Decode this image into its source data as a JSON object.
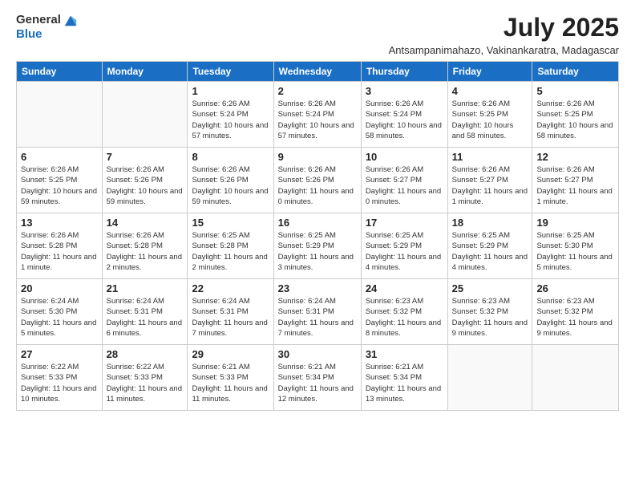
{
  "logo": {
    "general": "General",
    "blue": "Blue"
  },
  "title": "July 2025",
  "subtitle": "Antsampanimahazo, Vakinankaratra, Madagascar",
  "days_of_week": [
    "Sunday",
    "Monday",
    "Tuesday",
    "Wednesday",
    "Thursday",
    "Friday",
    "Saturday"
  ],
  "weeks": [
    [
      {
        "day": "",
        "info": ""
      },
      {
        "day": "",
        "info": ""
      },
      {
        "day": "1",
        "info": "Sunrise: 6:26 AM\nSunset: 5:24 PM\nDaylight: 10 hours and 57 minutes."
      },
      {
        "day": "2",
        "info": "Sunrise: 6:26 AM\nSunset: 5:24 PM\nDaylight: 10 hours and 57 minutes."
      },
      {
        "day": "3",
        "info": "Sunrise: 6:26 AM\nSunset: 5:24 PM\nDaylight: 10 hours and 58 minutes."
      },
      {
        "day": "4",
        "info": "Sunrise: 6:26 AM\nSunset: 5:25 PM\nDaylight: 10 hours and 58 minutes."
      },
      {
        "day": "5",
        "info": "Sunrise: 6:26 AM\nSunset: 5:25 PM\nDaylight: 10 hours and 58 minutes."
      }
    ],
    [
      {
        "day": "6",
        "info": "Sunrise: 6:26 AM\nSunset: 5:25 PM\nDaylight: 10 hours and 59 minutes."
      },
      {
        "day": "7",
        "info": "Sunrise: 6:26 AM\nSunset: 5:26 PM\nDaylight: 10 hours and 59 minutes."
      },
      {
        "day": "8",
        "info": "Sunrise: 6:26 AM\nSunset: 5:26 PM\nDaylight: 10 hours and 59 minutes."
      },
      {
        "day": "9",
        "info": "Sunrise: 6:26 AM\nSunset: 5:26 PM\nDaylight: 11 hours and 0 minutes."
      },
      {
        "day": "10",
        "info": "Sunrise: 6:26 AM\nSunset: 5:27 PM\nDaylight: 11 hours and 0 minutes."
      },
      {
        "day": "11",
        "info": "Sunrise: 6:26 AM\nSunset: 5:27 PM\nDaylight: 11 hours and 1 minute."
      },
      {
        "day": "12",
        "info": "Sunrise: 6:26 AM\nSunset: 5:27 PM\nDaylight: 11 hours and 1 minute."
      }
    ],
    [
      {
        "day": "13",
        "info": "Sunrise: 6:26 AM\nSunset: 5:28 PM\nDaylight: 11 hours and 1 minute."
      },
      {
        "day": "14",
        "info": "Sunrise: 6:26 AM\nSunset: 5:28 PM\nDaylight: 11 hours and 2 minutes."
      },
      {
        "day": "15",
        "info": "Sunrise: 6:25 AM\nSunset: 5:28 PM\nDaylight: 11 hours and 2 minutes."
      },
      {
        "day": "16",
        "info": "Sunrise: 6:25 AM\nSunset: 5:29 PM\nDaylight: 11 hours and 3 minutes."
      },
      {
        "day": "17",
        "info": "Sunrise: 6:25 AM\nSunset: 5:29 PM\nDaylight: 11 hours and 4 minutes."
      },
      {
        "day": "18",
        "info": "Sunrise: 6:25 AM\nSunset: 5:29 PM\nDaylight: 11 hours and 4 minutes."
      },
      {
        "day": "19",
        "info": "Sunrise: 6:25 AM\nSunset: 5:30 PM\nDaylight: 11 hours and 5 minutes."
      }
    ],
    [
      {
        "day": "20",
        "info": "Sunrise: 6:24 AM\nSunset: 5:30 PM\nDaylight: 11 hours and 5 minutes."
      },
      {
        "day": "21",
        "info": "Sunrise: 6:24 AM\nSunset: 5:31 PM\nDaylight: 11 hours and 6 minutes."
      },
      {
        "day": "22",
        "info": "Sunrise: 6:24 AM\nSunset: 5:31 PM\nDaylight: 11 hours and 7 minutes."
      },
      {
        "day": "23",
        "info": "Sunrise: 6:24 AM\nSunset: 5:31 PM\nDaylight: 11 hours and 7 minutes."
      },
      {
        "day": "24",
        "info": "Sunrise: 6:23 AM\nSunset: 5:32 PM\nDaylight: 11 hours and 8 minutes."
      },
      {
        "day": "25",
        "info": "Sunrise: 6:23 AM\nSunset: 5:32 PM\nDaylight: 11 hours and 9 minutes."
      },
      {
        "day": "26",
        "info": "Sunrise: 6:23 AM\nSunset: 5:32 PM\nDaylight: 11 hours and 9 minutes."
      }
    ],
    [
      {
        "day": "27",
        "info": "Sunrise: 6:22 AM\nSunset: 5:33 PM\nDaylight: 11 hours and 10 minutes."
      },
      {
        "day": "28",
        "info": "Sunrise: 6:22 AM\nSunset: 5:33 PM\nDaylight: 11 hours and 11 minutes."
      },
      {
        "day": "29",
        "info": "Sunrise: 6:21 AM\nSunset: 5:33 PM\nDaylight: 11 hours and 11 minutes."
      },
      {
        "day": "30",
        "info": "Sunrise: 6:21 AM\nSunset: 5:34 PM\nDaylight: 11 hours and 12 minutes."
      },
      {
        "day": "31",
        "info": "Sunrise: 6:21 AM\nSunset: 5:34 PM\nDaylight: 11 hours and 13 minutes."
      },
      {
        "day": "",
        "info": ""
      },
      {
        "day": "",
        "info": ""
      }
    ]
  ]
}
